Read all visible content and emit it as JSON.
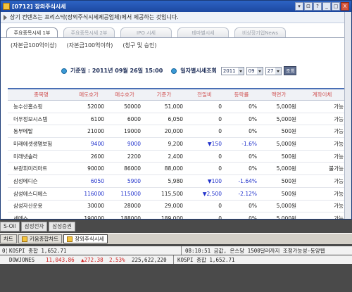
{
  "window": {
    "title": "[0712] 장외주식시세",
    "notice": "상기 컨텐츠는 프리스닥(장외주식시세제공업체)에서 제공하는 것입니다.",
    "controls": [
      "▾",
      "⊡",
      "?",
      "_",
      "□",
      "X"
    ]
  },
  "tabs": [
    {
      "label": "주요종목시세 1부",
      "active": true
    },
    {
      "label": "주요종목시세 2부",
      "active": false
    },
    {
      "label": "IPO 시세",
      "active": false
    },
    {
      "label": "테마별시세",
      "active": false
    },
    {
      "label": "비상장기업News",
      "active": false
    }
  ],
  "subtabs": [
    "(자본금100억이상)",
    "(자본금100억이하)",
    "(청구 및 승인)"
  ],
  "filter": {
    "date_text": "기준일 : 2011년 09월 26일 15:00",
    "daily_label": "일자별시세조회",
    "year": "2011",
    "month": "09",
    "day": "27",
    "query_label": "조회"
  },
  "table": {
    "headers": [
      "종목명",
      "매도호가",
      "매수호가",
      "기준가",
      "전일비",
      "등락률",
      "액면가",
      "계좌이체"
    ],
    "rows": [
      {
        "name": "농수산홈쇼핑",
        "sell": "52000",
        "buy": "50000",
        "base": "51,000",
        "change": "0",
        "rate": "0%",
        "par": "5,000원",
        "transfer": "가능",
        "blue": false
      },
      {
        "name": "더우정보시스템",
        "sell": "6100",
        "buy": "6000",
        "base": "6,050",
        "change": "0",
        "rate": "0%",
        "par": "5,000원",
        "transfer": "가능",
        "blue": false
      },
      {
        "name": "동부메탈",
        "sell": "21000",
        "buy": "19000",
        "base": "20,000",
        "change": "0",
        "rate": "0%",
        "par": "500원",
        "transfer": "가능",
        "blue": false
      },
      {
        "name": "미래에셋생명보험",
        "sell": "9400",
        "buy": "9000",
        "base": "9,200",
        "change": "▼150",
        "rate": "-1.6%",
        "par": "5,000원",
        "transfer": "가능",
        "blue": true
      },
      {
        "name": "미래넷솔라",
        "sell": "2600",
        "buy": "2200",
        "base": "2,400",
        "change": "0",
        "rate": "0%",
        "par": "500원",
        "transfer": "가능",
        "blue": false
      },
      {
        "name": "보광휘미리마트",
        "sell": "90000",
        "buy": "86000",
        "base": "88,000",
        "change": "0",
        "rate": "0%",
        "par": "5,000원",
        "transfer": "불가능",
        "blue": false
      },
      {
        "name": "삼성메디슨",
        "sell": "6050",
        "buy": "5900",
        "base": "5,980",
        "change": "▼100",
        "rate": "-1.64%",
        "par": "500원",
        "transfer": "가능",
        "blue": true
      },
      {
        "name": "삼성에스디에스",
        "sell": "116000",
        "buy": "115000",
        "base": "115,500",
        "change": "▼2,500",
        "rate": "-2.12%",
        "par": "500원",
        "transfer": "가능",
        "blue": true
      },
      {
        "name": "삼성자산운용",
        "sell": "30000",
        "buy": "28000",
        "base": "29,000",
        "change": "0",
        "rate": "0%",
        "par": "5,000원",
        "transfer": "가능",
        "blue": false
      },
      {
        "name": "세메스",
        "sell": "190000",
        "buy": "188000",
        "base": "189,000",
        "change": "0",
        "rate": "0%",
        "par": "5,000원",
        "transfer": "가능",
        "blue": false
      }
    ]
  },
  "tray": [
    "S-Oil",
    "삼성전자",
    "삼성증권"
  ],
  "taskbar": [
    {
      "label": "차트",
      "active": false
    },
    {
      "label": "키움종합차트",
      "active": false
    },
    {
      "label": "장외주식시세",
      "active": true
    }
  ],
  "ticker": {
    "row1_left": "KOSPI 종합  1,652.71",
    "row1_right": "08:10:51 금값, 온스당 1500달러까지 조정가능성-동양웹",
    "row2_a": "DOWJONES",
    "row2_b": "11,043.86",
    "row2_c": "▲272.38",
    "row2_d": "2.53%",
    "row2_e": "225,622,220",
    "row2_right": "KOSPI 종합  1,652.71",
    "row1_edge": "0)"
  }
}
